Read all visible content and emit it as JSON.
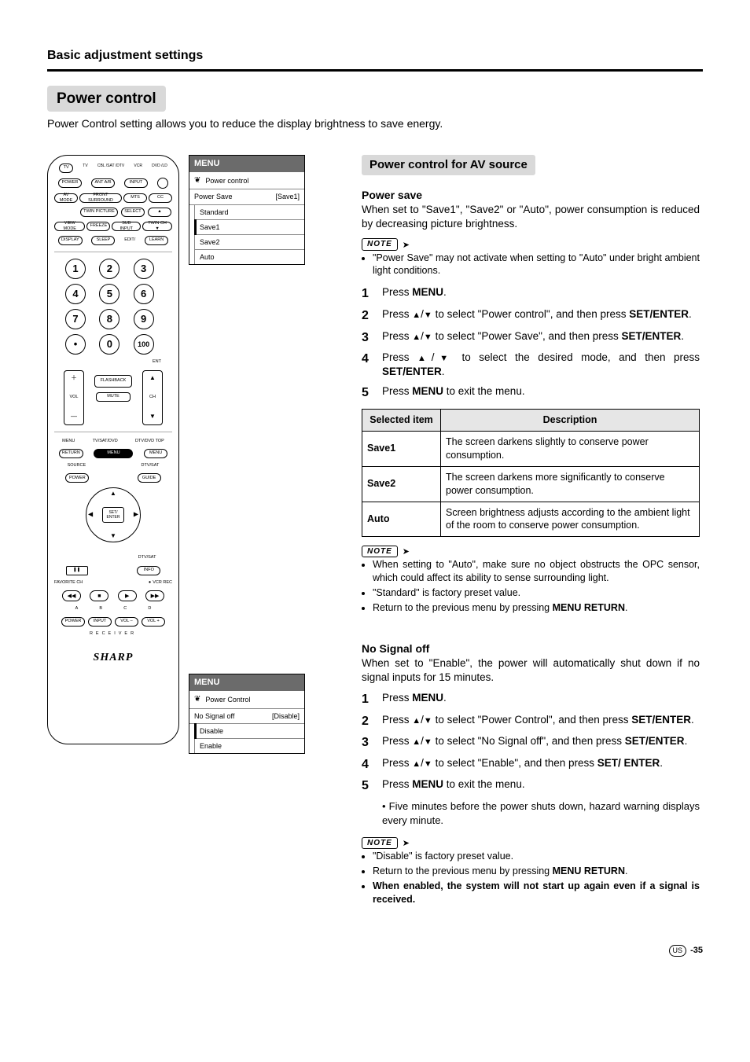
{
  "header": {
    "section": "Basic adjustment settings"
  },
  "title": "Power control",
  "intro": "Power Control setting allows you to reduce the display brightness to save energy.",
  "remote": {
    "selectors": [
      "TV",
      "CBL /SAT /DTV",
      "VCR",
      "DVD /LD"
    ],
    "row_tv": "TV",
    "rows": [
      [
        "POWER",
        "ANT A/B",
        "INPUT",
        "☼"
      ],
      [
        "AV MODE",
        "FRONT SURROUND",
        "MTS",
        "CC"
      ],
      [
        "TWIN PICTURE",
        "SELECT",
        "▲"
      ],
      [
        "VIEW MODE",
        "FREEZE",
        "SUB INPUT",
        "TWIN CH ▼"
      ],
      [
        "DISPLAY",
        "SLEEP",
        "EDIT/",
        "LEARN"
      ]
    ],
    "numbers": [
      "1",
      "2",
      "3",
      "4",
      "5",
      "6",
      "7",
      "8",
      "9",
      "•",
      "0",
      "100"
    ],
    "ent": "ENT",
    "vol": "VOL",
    "ch": "CH",
    "flashback": "FLASHBACK",
    "mute": "MUTE",
    "menu_row_left_lbl": "MENU",
    "menu_row_mid_lbl": "TV/SAT/DVD",
    "menu_row_right_lbl": "DTV/DVD TOP",
    "menu_row_left": "RETURN",
    "menu_row_right": "MENU",
    "source": "SOURCE",
    "dtvsat": "DTV/SAT",
    "guide": "GUIDE",
    "info": "INFO",
    "power_l": "POWER",
    "set_enter": "SET/ ENTER",
    "fav": "FAVORITE CH",
    "vcr": "VCR REC",
    "transport": [
      "◀◀",
      "■",
      "▶",
      "▶▶"
    ],
    "transport_lbls": [
      "A",
      "B",
      "C",
      "D"
    ],
    "pause": "❚❚",
    "receiver_label": "RECEIVER",
    "receiver": [
      "POWER",
      "INPUT",
      "VOL –",
      "VOL +"
    ],
    "brand": "SHARP"
  },
  "osd1": {
    "header": "MENU",
    "title": "Power control",
    "setting_label": "Power Save",
    "setting_value": "[Save1]",
    "options": [
      "Standard",
      "Save1",
      "Save2",
      "Auto"
    ],
    "selected_index": 1
  },
  "osd2": {
    "header": "MENU",
    "title": "Power Control",
    "setting_label": "No Signal off",
    "setting_value": "[Disable]",
    "options": [
      "Disable",
      "Enable"
    ],
    "selected_index": 0
  },
  "av": {
    "badge": "Power control for AV source",
    "h4": "Power save",
    "para": "When set to \"Save1\", \"Save2\" or \"Auto\", power consumption is reduced by decreasing picture brightness.",
    "note_label": "NOTE",
    "note1": [
      "\"Power Save\" may not activate when setting to \"Auto\" under bright ambient light conditions."
    ],
    "steps": [
      {
        "n": "1",
        "pre": "Press ",
        "b": "MENU",
        "post": "."
      },
      {
        "n": "2",
        "pre": "Press ",
        "arrows": true,
        "mid": " to select \"Power control\", and then press ",
        "b": "SET/ENTER",
        "post": "."
      },
      {
        "n": "3",
        "pre": "Press ",
        "arrows": true,
        "mid": " to select \"Power Save\", and then press ",
        "b": "SET/ENTER",
        "post": "."
      },
      {
        "n": "4",
        "pre": "Press ",
        "arrows": true,
        "mid": " to select the desired mode, and then press ",
        "b": "SET/ENTER",
        "post": "."
      },
      {
        "n": "5",
        "pre": "Press ",
        "b": "MENU",
        "post": " to exit the menu."
      }
    ],
    "table": {
      "head": [
        "Selected item",
        "Description"
      ],
      "rows": [
        [
          "Save1",
          "The screen darkens slightly to conserve power consumption."
        ],
        [
          "Save2",
          "The screen darkens more significantly to conserve power consumption."
        ],
        [
          "Auto",
          "Screen brightness adjusts according to the ambient light of the room to conserve power consumption."
        ]
      ]
    },
    "note2": [
      "When setting to \"Auto\", make sure no object obstructs the OPC sensor, which could affect its ability to sense surrounding light.",
      "\"Standard\" is factory preset value.",
      {
        "pre": "Return to the previous menu by pressing ",
        "b": "MENU RETURN",
        "post": "."
      }
    ]
  },
  "nosig": {
    "h4": "No Signal off",
    "para": "When set to \"Enable\", the power will automatically shut down if no signal inputs for 15 minutes.",
    "steps": [
      {
        "n": "1",
        "pre": "Press ",
        "b": "MENU",
        "post": "."
      },
      {
        "n": "2",
        "pre": "Press ",
        "arrows": true,
        "mid": " to select \"Power Control\", and then press ",
        "b": "SET/ENTER",
        "post": "."
      },
      {
        "n": "3",
        "pre": "Press ",
        "arrows": true,
        "mid": " to select \"No Signal off\", and then press ",
        "b": "SET/ENTER",
        "post": "."
      },
      {
        "n": "4",
        "pre": "Press ",
        "arrows": true,
        "mid": " to select \"Enable\", and then press ",
        "b": "SET/ ENTER",
        "post": "."
      },
      {
        "n": "5",
        "pre": "Press ",
        "b": "MENU",
        "post": " to exit the menu.",
        "sub": "Five minutes before the power shuts down, hazard warning displays every minute."
      }
    ],
    "note": [
      "\"Disable\" is factory preset value.",
      {
        "pre": "Return to the previous menu by pressing ",
        "b": "MENU RETURN",
        "post": "."
      },
      {
        "bold": true,
        "text": "When enabled, the system will not start up again even if a signal is received."
      }
    ]
  },
  "footer": {
    "region": "US",
    "page": "-35"
  }
}
